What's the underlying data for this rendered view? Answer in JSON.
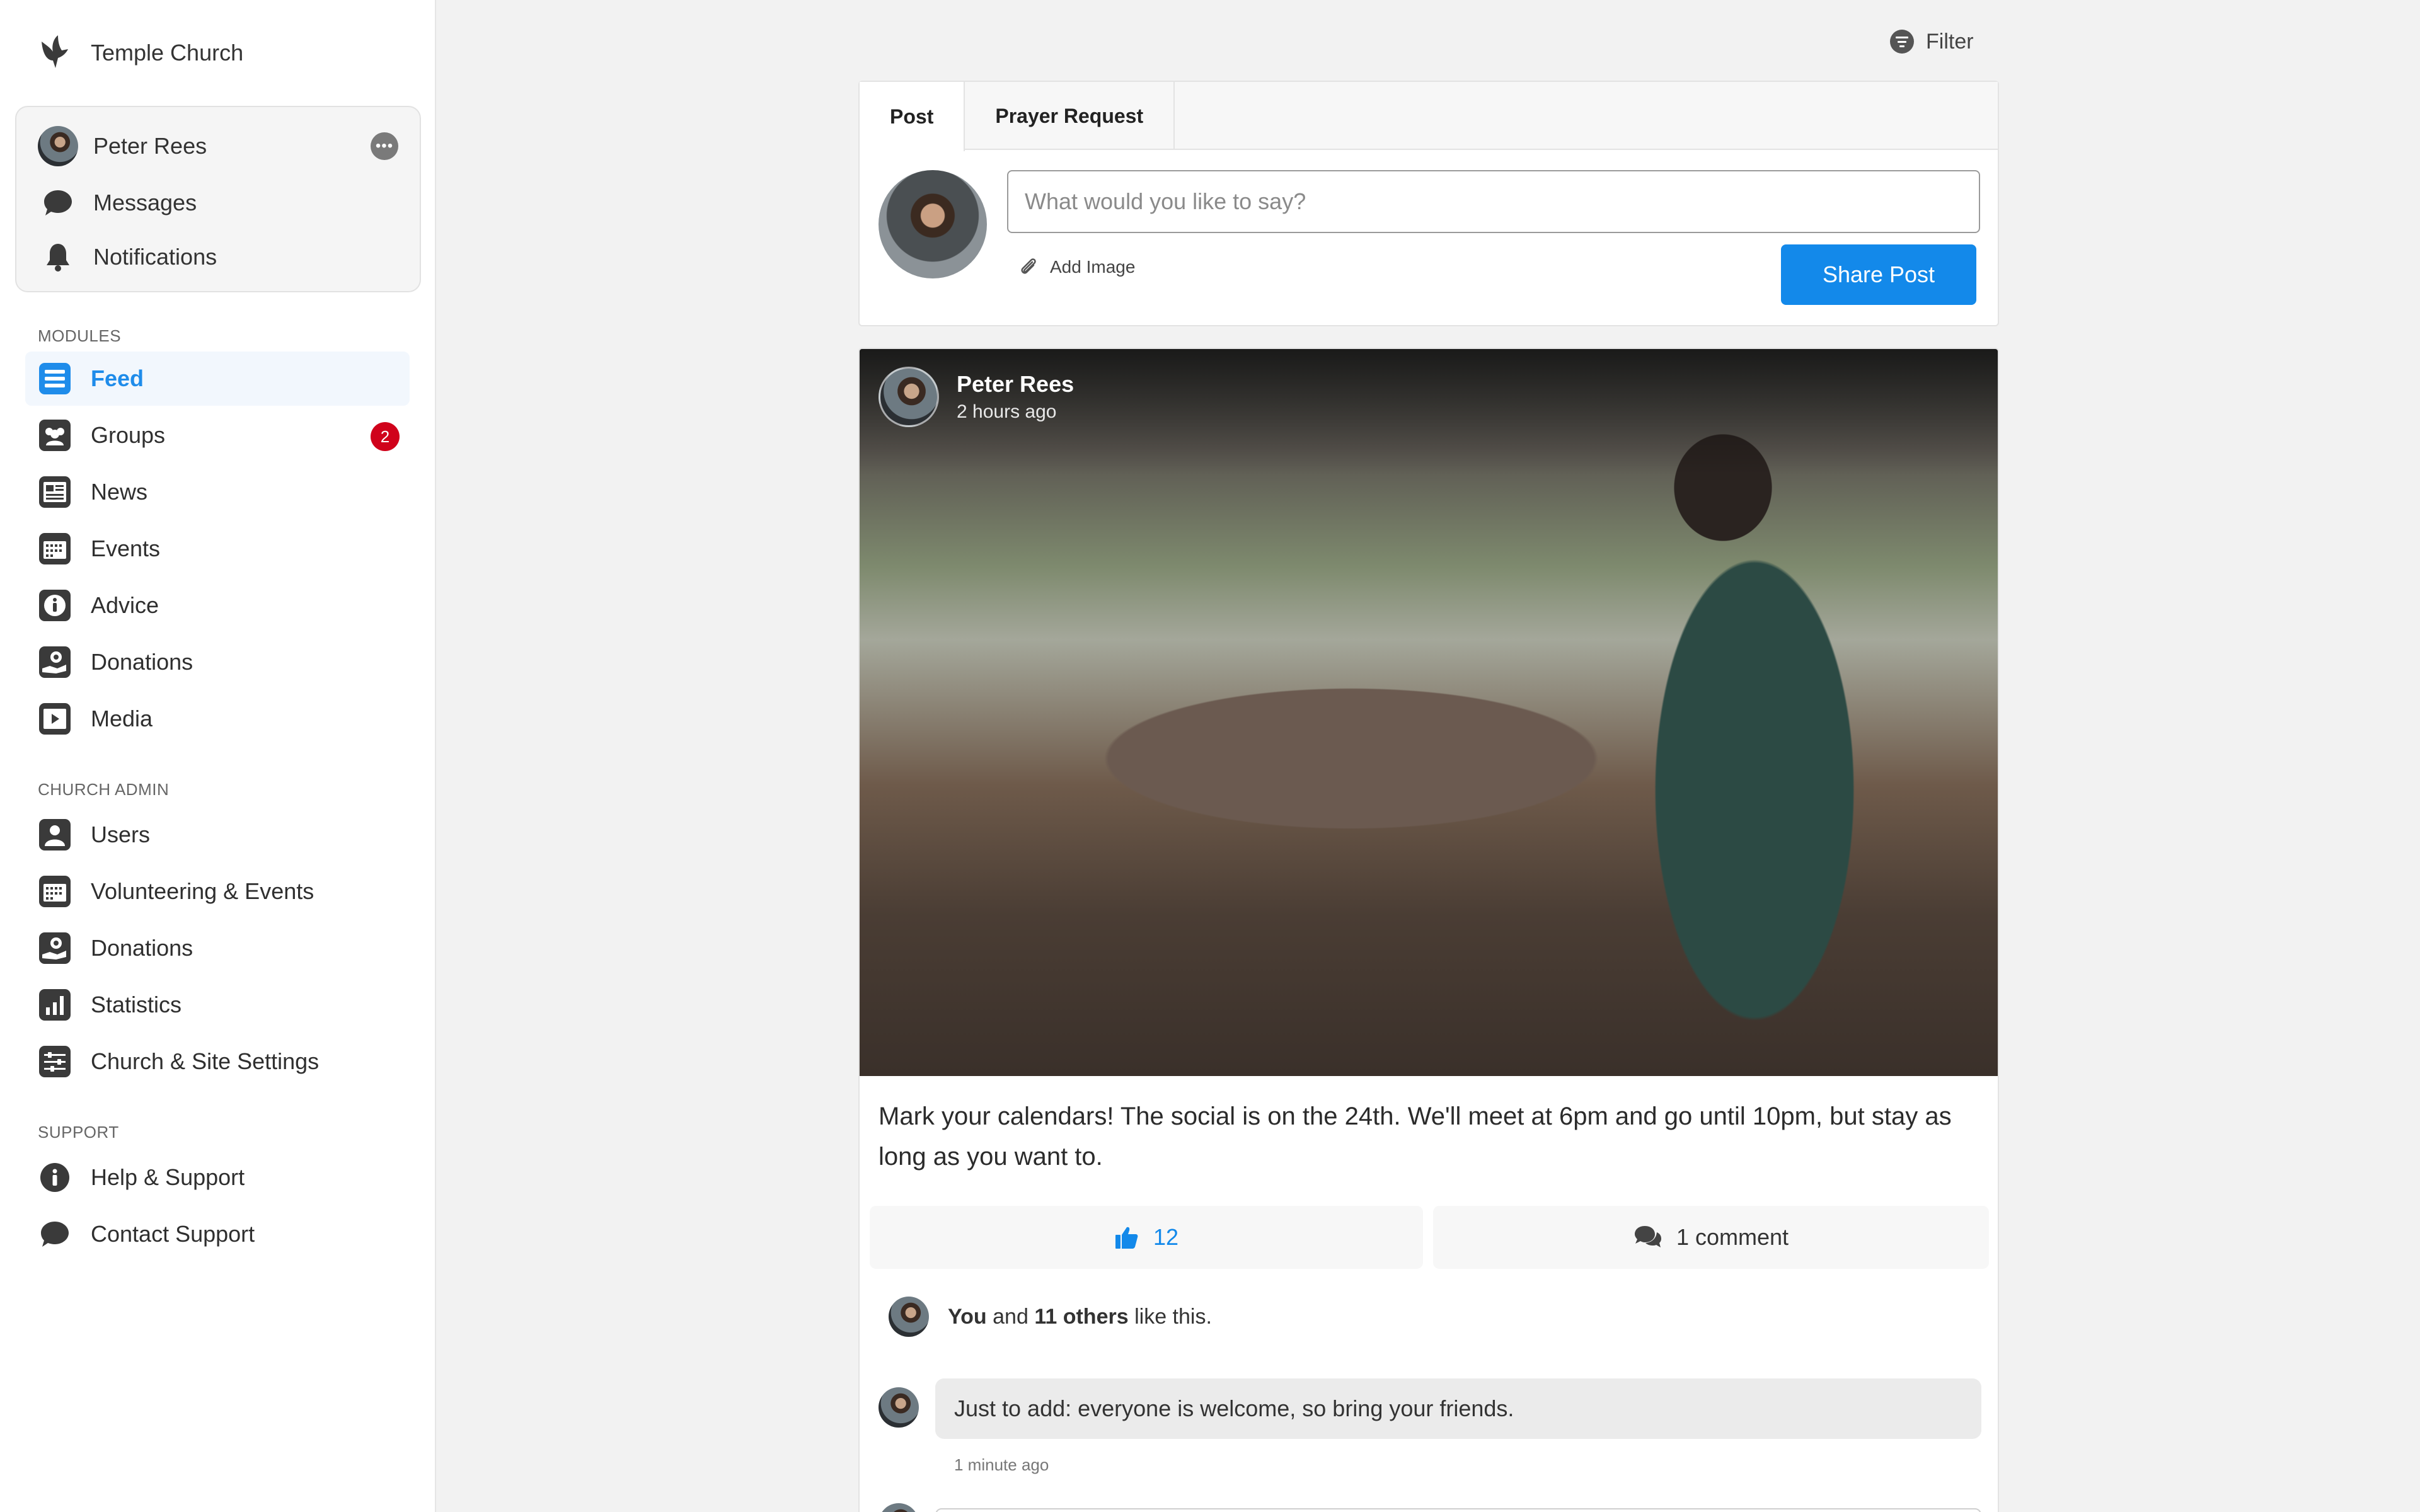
{
  "brand": {
    "name": "Temple Church"
  },
  "user_card": {
    "name": "Peter Rees",
    "more_label": "•••",
    "messages_label": "Messages",
    "notifications_label": "Notifications"
  },
  "modules": {
    "heading": "MODULES",
    "items": [
      {
        "label": "Feed",
        "icon": "feed-icon",
        "active": true
      },
      {
        "label": "Groups",
        "icon": "groups-icon",
        "badge": "2"
      },
      {
        "label": "News",
        "icon": "news-icon"
      },
      {
        "label": "Events",
        "icon": "calendar-icon"
      },
      {
        "label": "Advice",
        "icon": "info-icon"
      },
      {
        "label": "Donations",
        "icon": "donation-icon"
      },
      {
        "label": "Media",
        "icon": "media-icon"
      }
    ]
  },
  "church_admin": {
    "heading": "CHURCH ADMIN",
    "items": [
      {
        "label": "Users",
        "icon": "user-icon"
      },
      {
        "label": "Volunteering & Events",
        "icon": "calendar-icon"
      },
      {
        "label": "Donations",
        "icon": "donation-icon"
      },
      {
        "label": "Statistics",
        "icon": "statistics-icon"
      },
      {
        "label": "Church & Site Settings",
        "icon": "settings-sliders-icon"
      }
    ]
  },
  "support": {
    "heading": "SUPPORT",
    "items": [
      {
        "label": "Help & Support",
        "icon": "info-circle-icon"
      },
      {
        "label": "Contact Support",
        "icon": "chat-bubble-icon"
      }
    ]
  },
  "filter": {
    "label": "Filter"
  },
  "composer": {
    "tabs": [
      "Post",
      "Prayer Request"
    ],
    "active_tab": "Post",
    "placeholder": "What would you like to say?",
    "add_image_label": "Add Image",
    "share_label": "Share Post"
  },
  "post": {
    "author": "Peter Rees",
    "time": "2 hours ago",
    "text": "Mark your calendars! The social is on the 24th. We'll meet at 6pm and go until 10pm, but stay as long as you want to.",
    "like_count": "12",
    "comment_label": "1 comment",
    "likes_you": "You",
    "likes_and": " and ",
    "likes_others": "11 others",
    "likes_suffix": " like this.",
    "comment": {
      "text": "Just to add: everyone is welcome, so bring your friends.",
      "time": "1 minute ago"
    }
  },
  "colors": {
    "accent": "#1389ea",
    "badge": "#d0021b",
    "active_bg": "#f2f7fd",
    "sidebar_bg": "#ffffff",
    "page_bg": "#f2f2f2"
  }
}
